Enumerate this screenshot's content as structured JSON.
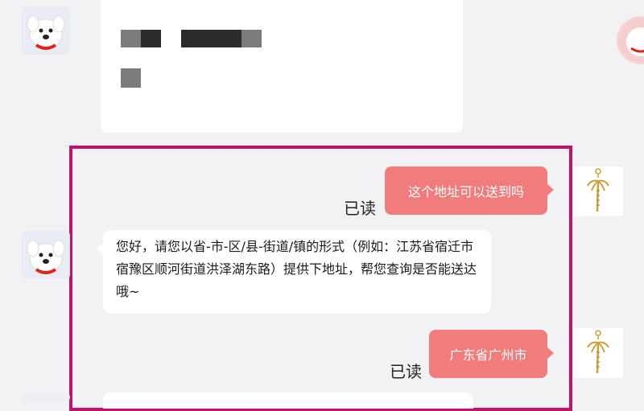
{
  "messages": [
    {
      "side": "right",
      "text": "这个地址可以送到吗",
      "status": "已读"
    },
    {
      "side": "left",
      "text": "您好，请您以省-市-区/县-街道/镇的形式（例如：江苏省宿迁市宿豫区顺河街道洪泽湖东路）提供下地址，帮您查询是否能送达哦~"
    },
    {
      "side": "right",
      "text": "广东省广州市",
      "status": "已读"
    }
  ],
  "colors": {
    "background": "#f2f2f4",
    "user_bubble": "#f07c7c",
    "highlight_border": "#c0146a"
  },
  "icons": {
    "agent_avatar": "joy-dog-mascot-icon",
    "user_avatar": "palm-tree-pendant-icon"
  }
}
